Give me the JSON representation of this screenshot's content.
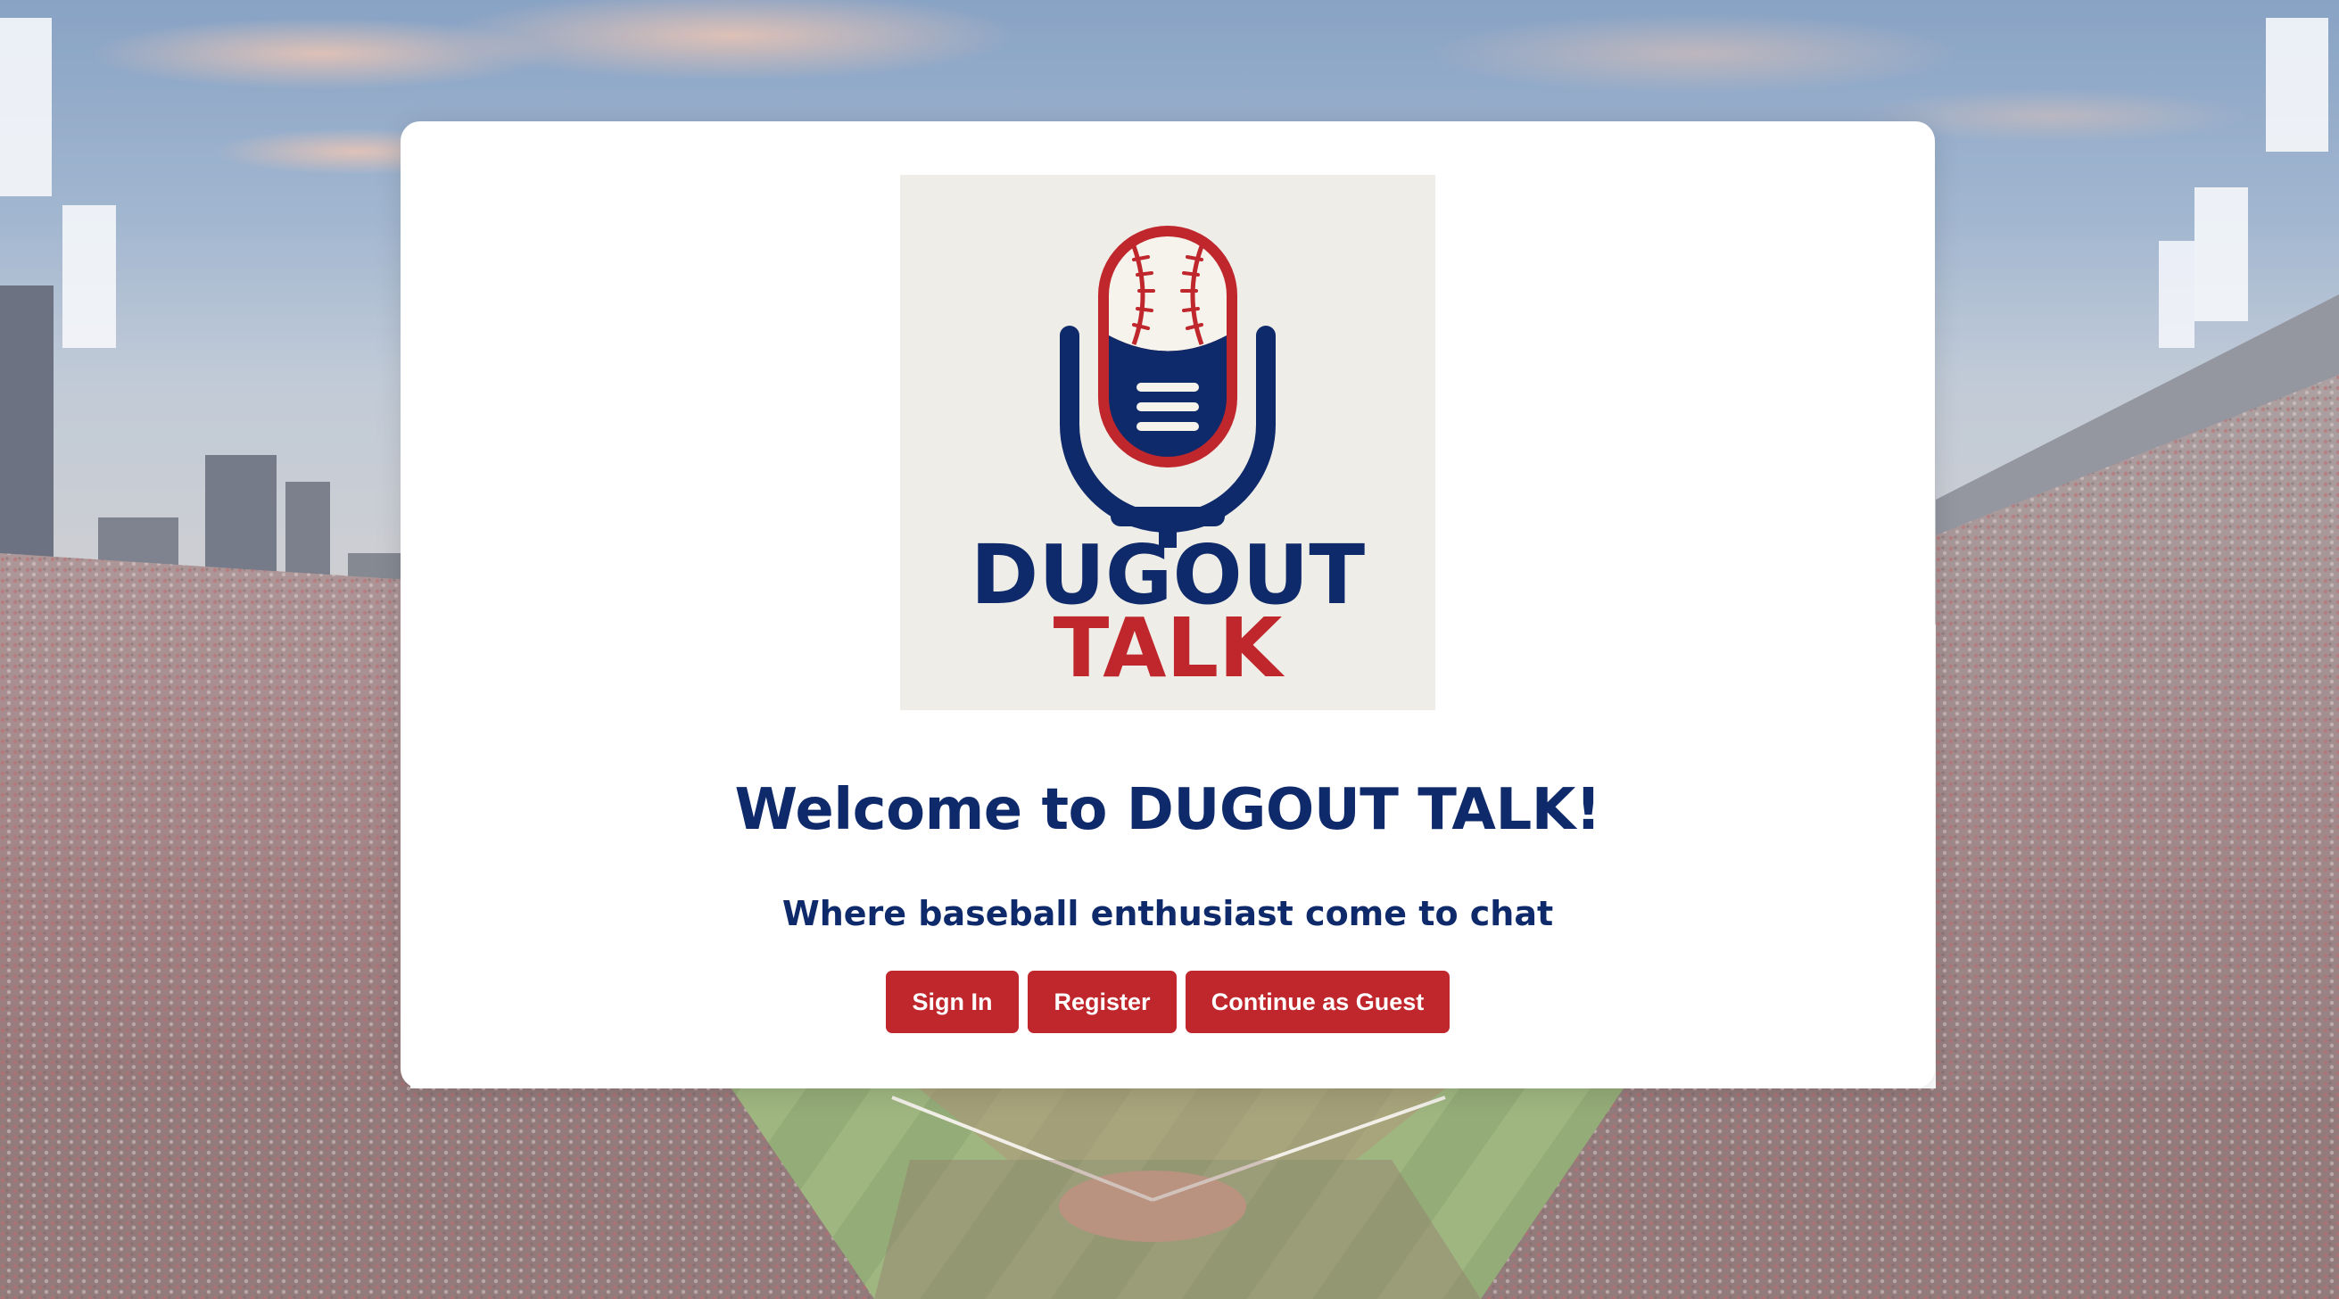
{
  "logo": {
    "line1": "DUGOUT",
    "line2": "TALK"
  },
  "welcome_title": "Welcome to DUGOUT TALK!",
  "tagline": "Where baseball enthusiast come to chat",
  "buttons": {
    "sign_in": "Sign In",
    "register": "Register",
    "guest": "Continue as Guest"
  },
  "colors": {
    "brand_navy": "#0f2a6b",
    "brand_red": "#c0272d",
    "logo_background": "#eeede7"
  }
}
